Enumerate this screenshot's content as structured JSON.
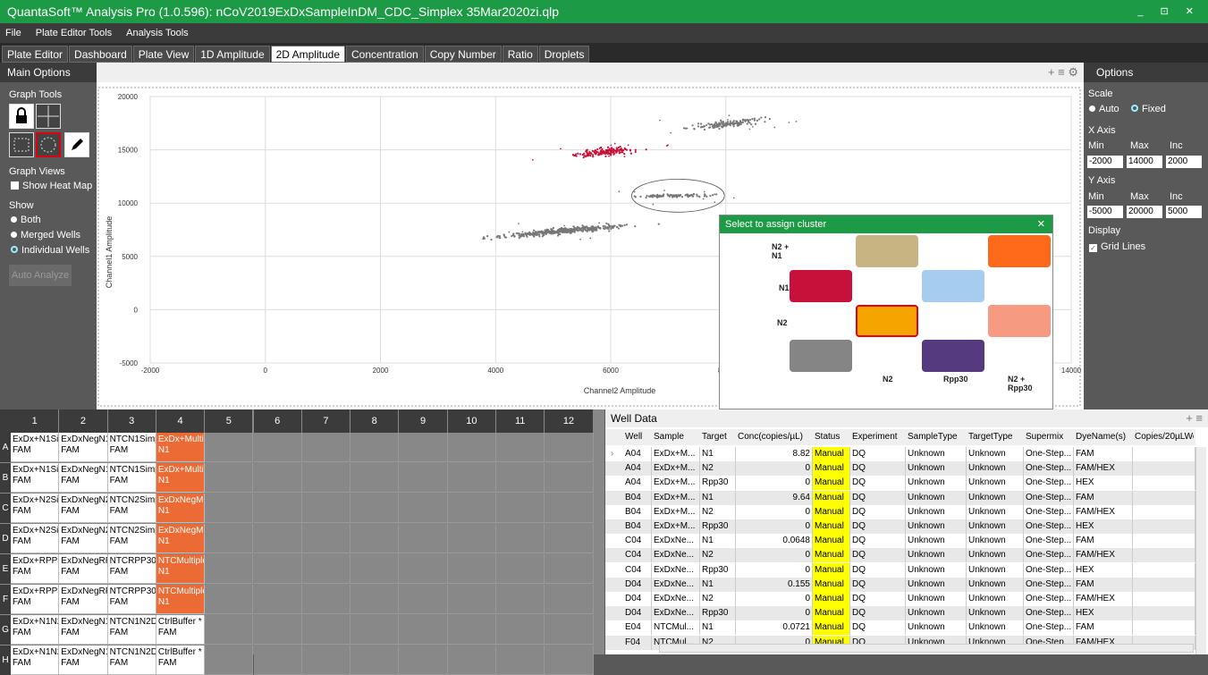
{
  "titlebar": {
    "title": "QuantaSoft™ Analysis Pro (1.0.596): nCoV2019ExDxSampleInDM_CDC_Simplex 35Mar2020zi.qlp",
    "controls": "_ ⊡ ✕"
  },
  "menu": [
    "File",
    "Plate Editor Tools",
    "Analysis Tools"
  ],
  "tabs": [
    "Plate Editor",
    "Dashboard",
    "Plate View",
    "1D Amplitude",
    "2D Amplitude",
    "Concentration",
    "Copy Number",
    "Ratio",
    "Droplets"
  ],
  "active_tab": "2D Amplitude",
  "left": {
    "title": "Main Options",
    "graph_tools": "Graph Tools",
    "graph_views": "Graph Views",
    "show_heat_map": "Show Heat Map",
    "show": "Show",
    "options": [
      "Both",
      "Merged Wells",
      "Individual Wells"
    ],
    "selected_option": "Individual Wells",
    "auto_analyze": "Auto Analyze"
  },
  "graph_toolbar": "+ ≡ ⚙",
  "chart_data": {
    "type": "scatter",
    "xlabel": "Channel2 Amplitude",
    "ylabel": "Channel1 Amplitude",
    "xlim": [
      -2000,
      14000
    ],
    "ylim": [
      -5000,
      20000
    ],
    "xticks": [
      -2000,
      0,
      2000,
      4000,
      6000,
      8000,
      14000
    ],
    "yticks": [
      -5000,
      0,
      5000,
      10000,
      15000,
      20000
    ],
    "xtick_labels": [
      "-2000",
      "0",
      "2000",
      "4000",
      "6000",
      "8000",
      "14000"
    ],
    "ytick_labels": [
      "-5000",
      "0",
      "5000",
      "10000",
      "15000",
      "20000"
    ],
    "grid": true,
    "clusters": [
      {
        "name": "N1 cluster",
        "color": "#c8113a",
        "cx": 5900,
        "cy": 14800,
        "n": 150,
        "sx": 200,
        "sy": 280,
        "tilt": 0.55
      },
      {
        "name": "gray upper",
        "color": "#777777",
        "cx": 8000,
        "cy": 17400,
        "n": 140,
        "sx": 230,
        "sy": 280,
        "tilt": 0.6
      },
      {
        "name": "gray mid",
        "color": "#777777",
        "cx": 7100,
        "cy": 10700,
        "n": 90,
        "sx": 240,
        "sy": 120,
        "tilt": 0.15
      },
      {
        "name": "gray lower",
        "color": "#777777",
        "cx": 5200,
        "cy": 7400,
        "n": 380,
        "sx": 400,
        "sy": 220,
        "tilt": 0.5
      }
    ],
    "ellipse": {
      "cx": 7170,
      "cy": 10700,
      "rx": 620,
      "ry": 1550
    }
  },
  "right": {
    "title": "Options",
    "scale": "Scale",
    "scale_auto": "Auto",
    "scale_fixed": "Fixed",
    "x_axis": "X Axis",
    "y_axis": "Y Axis",
    "min_lbl": "Min",
    "max_lbl": "Max",
    "inc_lbl": "Inc",
    "x_min": "-2000",
    "x_max": "14000",
    "x_inc": "2000",
    "y_min": "-5000",
    "y_max": "20000",
    "y_inc": "5000",
    "display": "Display",
    "grid_lines": "Grid Lines"
  },
  "popup": {
    "title": "Select to assign cluster",
    "close": "✕",
    "lbl_n2n1": "N2 +\nN1",
    "lbl_n1": "N1",
    "lbl_n2": "N2",
    "lbl_bottom_n2": "N2",
    "lbl_rpp30": "Rpp30",
    "lbl_n2rpp30": "N2 +\nRpp30",
    "colors": {
      "tan": "#c7b483",
      "orange": "#ff6a1a",
      "crimson": "#c8113a",
      "lightblue": "#a6cdf0",
      "amber": "#f5a400",
      "salmon": "#f79a82",
      "gray": "#858585",
      "purple": "#553a80"
    }
  },
  "plate": {
    "cols": [
      "1",
      "2",
      "3",
      "4",
      "5",
      "6",
      "7",
      "8",
      "9",
      "10",
      "11",
      "12"
    ],
    "rows": [
      "A",
      "B",
      "C",
      "D",
      "E",
      "F",
      "G",
      "H"
    ],
    "cells": [
      [
        [
          "ExDx+N1Sir",
          "FAM"
        ],
        [
          "ExDxNegN1",
          "FAM"
        ],
        [
          "NTCN1Simp",
          "FAM"
        ],
        [
          "ExDx+Multi",
          "N1"
        ]
      ],
      [
        [
          "ExDx+N1Sir",
          "FAM"
        ],
        [
          "ExDxNegN1",
          "FAM"
        ],
        [
          "NTCN1Simp",
          "FAM"
        ],
        [
          "ExDx+Multi",
          "N1"
        ]
      ],
      [
        [
          "ExDx+N2Sir",
          "FAM"
        ],
        [
          "ExDxNegN2",
          "FAM"
        ],
        [
          "NTCN2Simp",
          "FAM"
        ],
        [
          "ExDxNegMu",
          "N1"
        ]
      ],
      [
        [
          "ExDx+N2Sir",
          "FAM"
        ],
        [
          "ExDxNegN2",
          "FAM"
        ],
        [
          "NTCN2Simp",
          "FAM"
        ],
        [
          "ExDxNegMu",
          "N1"
        ]
      ],
      [
        [
          "ExDx+RPP3(",
          "FAM"
        ],
        [
          "ExDxNegRP",
          "FAM"
        ],
        [
          "NTCRPP30S",
          "FAM"
        ],
        [
          "NTCMultiplo",
          "N1"
        ]
      ],
      [
        [
          "ExDx+RPP3(",
          "FAM"
        ],
        [
          "ExDxNegRP",
          "FAM"
        ],
        [
          "NTCRPP30S",
          "FAM"
        ],
        [
          "NTCMultiplo",
          "N1"
        ]
      ],
      [
        [
          "ExDx+N1N2",
          "FAM"
        ],
        [
          "ExDxNegN1",
          "FAM"
        ],
        [
          "NTCN1N2D",
          "FAM"
        ],
        [
          "CtrlBuffer *",
          "FAM"
        ]
      ],
      [
        [
          "ExDx+N1N2",
          "FAM"
        ],
        [
          "ExDxNegN1",
          "FAM"
        ],
        [
          "NTCN1N2D",
          "FAM"
        ],
        [
          "CtrlBuffer *",
          "FAM"
        ]
      ]
    ]
  },
  "welldata": {
    "title": "Well Data",
    "plus": "+ ≡",
    "columns": [
      "Well",
      "Sample",
      "Target",
      "Conc(copies/µL)",
      "Status",
      "Experiment",
      "SampleType",
      "TargetType",
      "Supermix",
      "DyeName(s)",
      "Copies/20µLWel"
    ],
    "rows": [
      [
        "A04",
        "ExDx+M...",
        "N1",
        "8.82",
        "Manual",
        "DQ",
        "Unknown",
        "Unknown",
        "One-Step...",
        "FAM",
        ""
      ],
      [
        "A04",
        "ExDx+M...",
        "N2",
        "0",
        "Manual",
        "DQ",
        "Unknown",
        "Unknown",
        "One-Step...",
        "FAM/HEX",
        ""
      ],
      [
        "A04",
        "ExDx+M...",
        "Rpp30",
        "0",
        "Manual",
        "DQ",
        "Unknown",
        "Unknown",
        "One-Step...",
        "HEX",
        ""
      ],
      [
        "B04",
        "ExDx+M...",
        "N1",
        "9.64",
        "Manual",
        "DQ",
        "Unknown",
        "Unknown",
        "One-Step...",
        "FAM",
        ""
      ],
      [
        "B04",
        "ExDx+M...",
        "N2",
        "0",
        "Manual",
        "DQ",
        "Unknown",
        "Unknown",
        "One-Step...",
        "FAM/HEX",
        ""
      ],
      [
        "B04",
        "ExDx+M...",
        "Rpp30",
        "0",
        "Manual",
        "DQ",
        "Unknown",
        "Unknown",
        "One-Step...",
        "HEX",
        ""
      ],
      [
        "C04",
        "ExDxNe...",
        "N1",
        "0.0648",
        "Manual",
        "DQ",
        "Unknown",
        "Unknown",
        "One-Step...",
        "FAM",
        ""
      ],
      [
        "C04",
        "ExDxNe...",
        "N2",
        "0",
        "Manual",
        "DQ",
        "Unknown",
        "Unknown",
        "One-Step...",
        "FAM/HEX",
        ""
      ],
      [
        "C04",
        "ExDxNe...",
        "Rpp30",
        "0",
        "Manual",
        "DQ",
        "Unknown",
        "Unknown",
        "One-Step...",
        "HEX",
        ""
      ],
      [
        "D04",
        "ExDxNe...",
        "N1",
        "0.155",
        "Manual",
        "DQ",
        "Unknown",
        "Unknown",
        "One-Step...",
        "FAM",
        ""
      ],
      [
        "D04",
        "ExDxNe...",
        "N2",
        "0",
        "Manual",
        "DQ",
        "Unknown",
        "Unknown",
        "One-Step...",
        "FAM/HEX",
        ""
      ],
      [
        "D04",
        "ExDxNe...",
        "Rpp30",
        "0",
        "Manual",
        "DQ",
        "Unknown",
        "Unknown",
        "One-Step...",
        "HEX",
        ""
      ],
      [
        "E04",
        "NTCMul...",
        "N1",
        "0.0721",
        "Manual",
        "DQ",
        "Unknown",
        "Unknown",
        "One-Step...",
        "FAM",
        ""
      ],
      [
        "F04",
        "NTCMul...",
        "N2",
        "0",
        "Manual",
        "DQ",
        "Unknown",
        "Unknown",
        "One-Step...",
        "FAM/HEX",
        ""
      ]
    ]
  }
}
